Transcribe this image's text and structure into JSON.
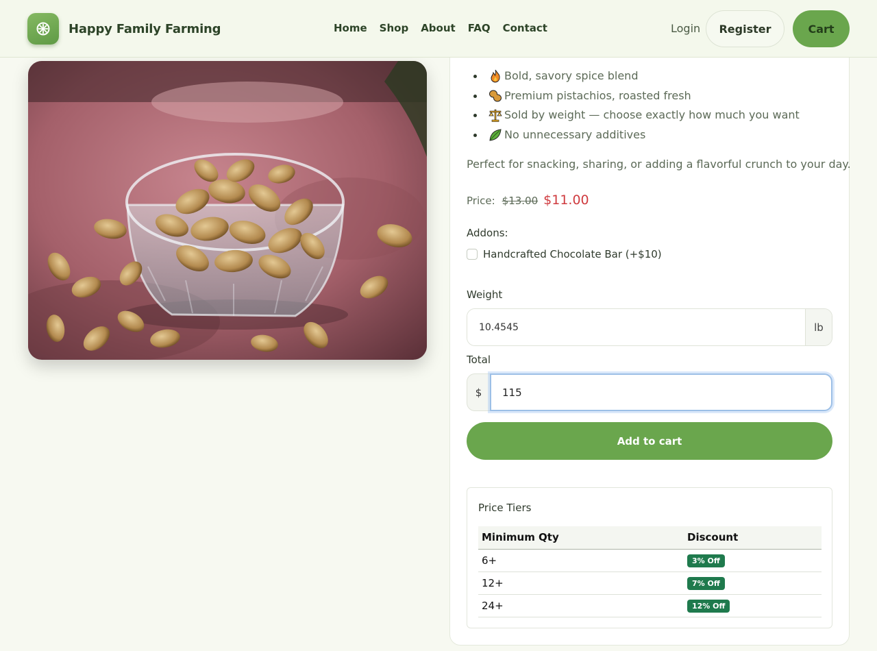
{
  "header": {
    "brand_name": "Happy Family Farming",
    "brand_icon": "flower-icon",
    "nav": [
      "Home",
      "Shop",
      "About",
      "FAQ",
      "Contact"
    ],
    "login_label": "Login",
    "register_label": "Register",
    "cart_label": "Cart"
  },
  "product": {
    "image_alt": "Pistachios in a glass bowl",
    "features": [
      {
        "icon": "fire-icon",
        "text": "Bold, savory spice blend"
      },
      {
        "icon": "peanut-icon",
        "text": "Premium pistachios, roasted fresh"
      },
      {
        "icon": "scale-icon",
        "text": "Sold by weight — choose exactly how much you want"
      },
      {
        "icon": "leaf-icon",
        "text": "No unnecessary additives"
      }
    ],
    "description": "Perfect for snacking, sharing, or adding a flavorful crunch to your day.",
    "price_label": "Price:",
    "price_old": "$13.00",
    "price_new": "$11.00",
    "addons_label": "Addons:",
    "addon_option": "Handcrafted Chocolate Bar (+$10)",
    "addon_checked": false
  },
  "form": {
    "weight_label": "Weight",
    "weight_value": "10.4545",
    "weight_unit": "lb",
    "total_label": "Total",
    "currency_symbol": "$",
    "total_value": "115",
    "add_to_cart_label": "Add to cart"
  },
  "tiers": {
    "title": "Price Tiers",
    "columns": [
      "Minimum Qty",
      "Discount"
    ],
    "rows": [
      {
        "qty": "6+",
        "discount": "3% Off"
      },
      {
        "qty": "12+",
        "discount": "7% Off"
      },
      {
        "qty": "24+",
        "discount": "12% Off"
      }
    ],
    "badge_color": "#1f7a4d"
  },
  "colors": {
    "accent": "#6aa64d",
    "sale_price": "#cf3b3f",
    "heading": "#2d4428"
  }
}
